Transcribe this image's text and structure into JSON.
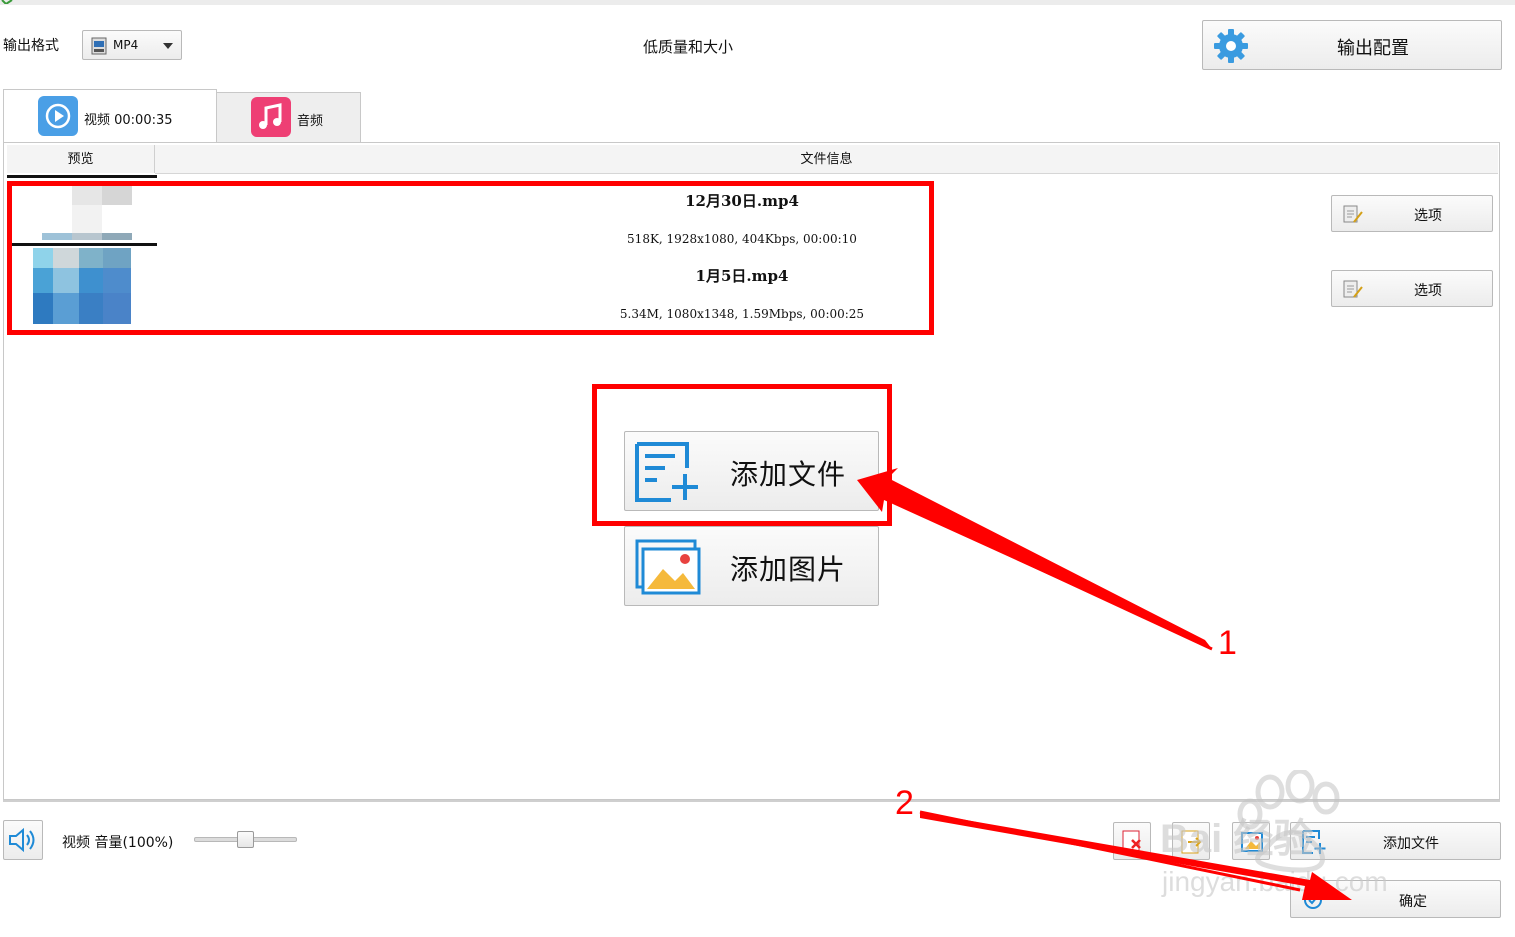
{
  "toolbar": {
    "format_label": "输出格式",
    "format_value": "MP4",
    "quality_text": "低质量和大小",
    "output_config_label": "输出配置"
  },
  "tabs": {
    "video_label": "视频 00:00:35",
    "audio_label": "音频"
  },
  "table": {
    "col_preview": "预览",
    "col_info": "文件信息"
  },
  "files": [
    {
      "name": "12月30日.mp4",
      "meta": "518K, 1928x1080, 404Kbps, 00:00:10",
      "option_label": "选项"
    },
    {
      "name": "1月5日.mp4",
      "meta": "5.34M, 1080x1348, 1.59Mbps, 00:00:25",
      "option_label": "选项"
    }
  ],
  "center": {
    "add_file_label": "添加文件",
    "add_image_label": "添加图片"
  },
  "bottom": {
    "volume_label": "视频  音量(100%)",
    "volume_level": 0.5,
    "add_file_label": "添加文件",
    "ok_label": "确定"
  },
  "annotations": {
    "step1": "1",
    "step2": "2"
  },
  "watermark": {
    "line1": "Bai 经验",
    "line2": "jingyan.baidu.com"
  },
  "colors": {
    "annotation_red": "#ff0000",
    "video_tab_icon": "#4a9fe6",
    "audio_tab_icon": "#ee3f74",
    "gear_blue": "#3a9be0"
  }
}
